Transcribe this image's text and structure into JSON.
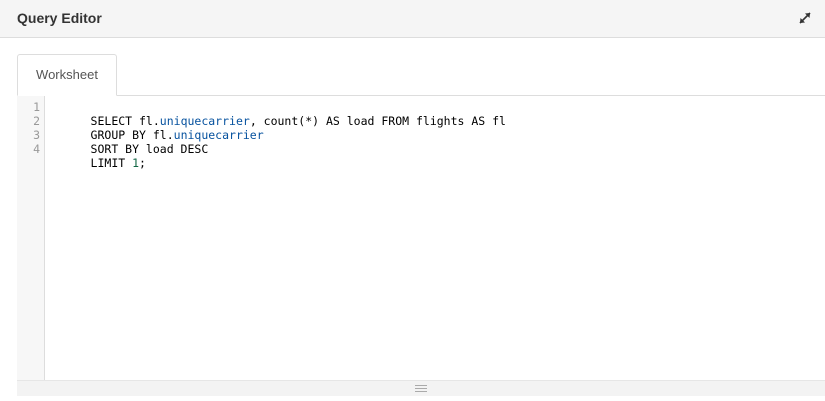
{
  "header": {
    "title": "Query Editor",
    "expand_icon": "expand-arrows-icon"
  },
  "tabs": [
    {
      "label": "Worksheet",
      "active": true
    }
  ],
  "editor": {
    "line_numbers": [
      "1",
      "2",
      "3",
      "4"
    ],
    "lines": [
      [
        {
          "text": "SELECT fl.",
          "type": "plain"
        },
        {
          "text": "uniquecarrier",
          "type": "prop"
        },
        {
          "text": ", count(*) AS load FROM flights AS fl",
          "type": "plain"
        }
      ],
      [
        {
          "text": "GROUP BY fl.",
          "type": "plain"
        },
        {
          "text": "uniquecarrier",
          "type": "prop"
        }
      ],
      [
        {
          "text": "SORT BY load DESC",
          "type": "plain"
        }
      ],
      [
        {
          "text": "LIMIT ",
          "type": "plain"
        },
        {
          "text": "1",
          "type": "num"
        },
        {
          "text": ";",
          "type": "plain"
        }
      ]
    ]
  },
  "resize_handle": {
    "icon": "drag-grip-icon"
  },
  "colors": {
    "keyword_property": "#05519e",
    "number": "#116644",
    "header_bg": "#f5f5f5"
  }
}
